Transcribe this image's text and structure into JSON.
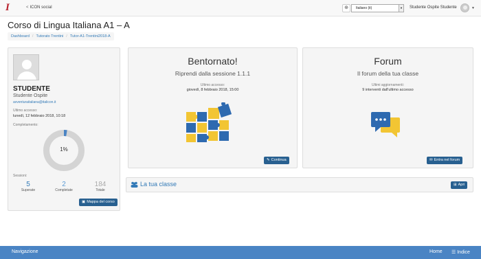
{
  "topbar": {
    "logo": "I",
    "social_label": "ICON social",
    "language": "Italiano (it)",
    "user_name": "Studente Ospite Studente"
  },
  "page": {
    "title": "Corso di Lingua Italiana A1 – A",
    "breadcrumb": [
      "Dashboard",
      "Tutorato Trentini",
      "Tutor-A1-Trentini2018-A"
    ]
  },
  "student": {
    "role": "STUDENTE",
    "name": "Studente Ospite",
    "email": "avventuraitaliana@italicon.it",
    "last_access_label": "Ultimo accesso:",
    "last_access": "lunedì, 12 febbraio 2018, 10:18",
    "completion_label": "Completamento:",
    "completion_value": "1%",
    "completion_fraction": 0.01,
    "sessions_label": "Sessioni:",
    "stats": [
      {
        "value": "5",
        "label": "Superate"
      },
      {
        "value": "2",
        "label": "Completate"
      },
      {
        "value": "184",
        "label": "Totale"
      }
    ],
    "map_button": "Mappa del corso"
  },
  "welcome": {
    "title": "Bentornato!",
    "subtitle": "Riprendi dalla sessione 1.1.1",
    "access_label": "Ultimo accesso:",
    "access_value": "giovedì, 8 febbraio 2018, 15:00",
    "button": "Continua"
  },
  "forum": {
    "title": "Forum",
    "subtitle": "Il forum della tua classe",
    "updates_label": "Ultimi aggiornamenti:",
    "updates_value": "9 interventi dall'ultimo accesso",
    "button": "Entra nel forum"
  },
  "class": {
    "title": "La tua classe",
    "button": "Apri"
  },
  "footer": {
    "nav": "Navigazione",
    "home": "Home",
    "index": "Indice"
  },
  "colors": {
    "primary_button": "#286090",
    "link": "#337ab7",
    "footer": "#4a84c4",
    "donut_track": "#d4d4d4",
    "donut_fill": "#4a84c4"
  }
}
